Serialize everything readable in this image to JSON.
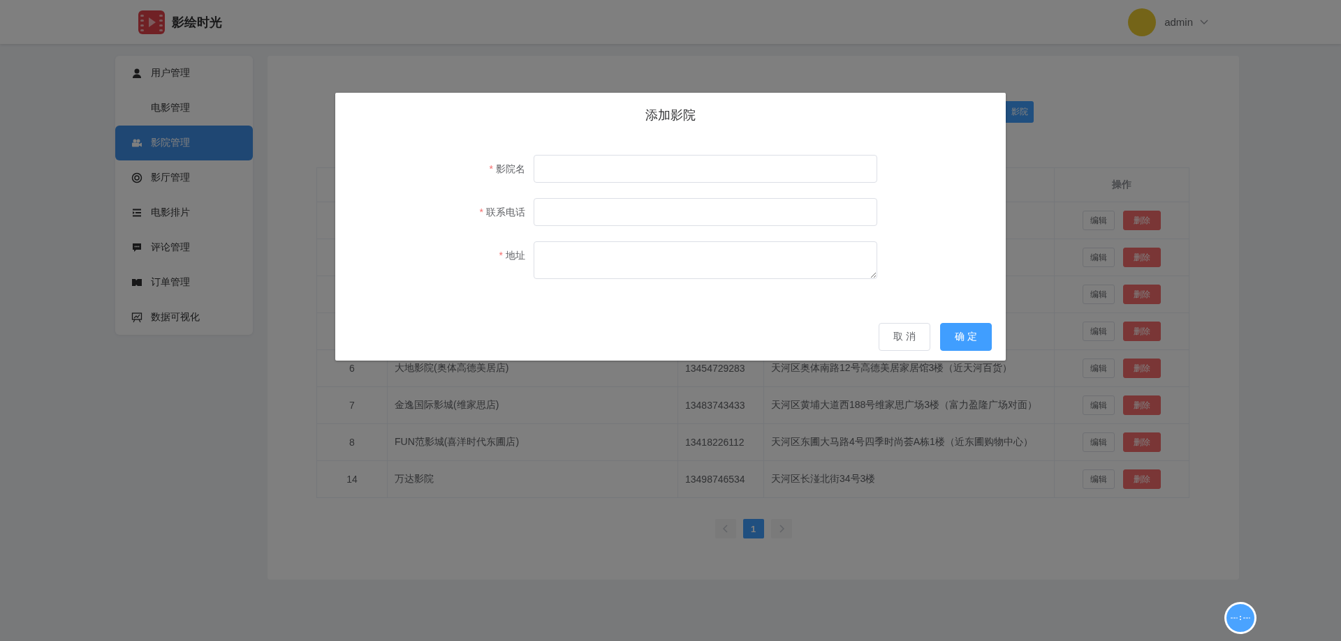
{
  "header": {
    "app_name": "影绘时光",
    "user": "admin"
  },
  "sidebar": {
    "items": [
      {
        "label": "用户管理",
        "selected": false
      },
      {
        "label": "电影管理",
        "selected": false
      },
      {
        "label": "影院管理",
        "selected": true
      },
      {
        "label": "影厅管理",
        "selected": false
      },
      {
        "label": "电影排片",
        "selected": false
      },
      {
        "label": "评论管理",
        "selected": false
      },
      {
        "label": "订单管理",
        "selected": false
      },
      {
        "label": "数据可视化",
        "selected": false
      }
    ]
  },
  "toolbar": {
    "add_button": "影院"
  },
  "table": {
    "action_header": "操作",
    "rows": [
      {
        "actions": [
          "编辑",
          "删除"
        ]
      },
      {
        "actions": [
          "编辑",
          "删除"
        ]
      },
      {
        "actions": [
          "编辑",
          "删除"
        ]
      },
      {
        "actions": [
          "编辑",
          "删除"
        ]
      },
      {
        "id": "6",
        "name": "大地影院(奥体高德美居店)",
        "phone": "13454729283",
        "address": "天河区奥体南路12号高德美居家居馆3楼（近天河百货）",
        "actions": [
          "编辑",
          "删除"
        ]
      },
      {
        "id": "7",
        "name": "金逸国际影城(维家思店)",
        "phone": "13483743433",
        "address": "天河区黄埔大道西188号维家思广场3楼（富力盈隆广场对面）",
        "actions": [
          "编辑",
          "删除"
        ]
      },
      {
        "id": "8",
        "name": "FUN范影城(喜洋时代东圃店)",
        "phone": "13418226112",
        "address": "天河区东圃大马路4号四季时尚荟A栋1楼（近东圃购物中心）",
        "actions": [
          "编辑",
          "删除"
        ]
      },
      {
        "id": "14",
        "name": "万达影院",
        "phone": "13498746534",
        "address": "天河区长湴北街34号3楼",
        "actions": [
          "编辑",
          "删除"
        ]
      }
    ]
  },
  "pagination": {
    "pages": [
      {
        "label": "1",
        "selected": true
      }
    ]
  },
  "dialog": {
    "title": "添加影院",
    "required_mark": "*",
    "fields": [
      {
        "label": "影院名",
        "required": true,
        "kind": "input"
      },
      {
        "label": "联系电话",
        "required": true,
        "kind": "input"
      },
      {
        "label": "地址",
        "required": true,
        "kind": "textarea"
      }
    ],
    "buttons": [
      {
        "label": "取 消",
        "kind": "default"
      },
      {
        "label": "确 定",
        "kind": "primary"
      }
    ]
  }
}
